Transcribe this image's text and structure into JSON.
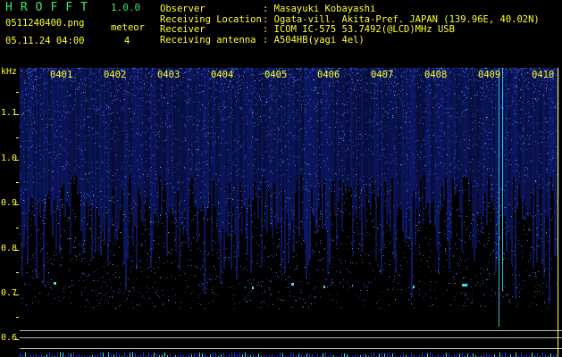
{
  "header": {
    "app_title": "HROFFT",
    "app_version": "1.0.0",
    "filename": "0511240400.png",
    "datetime": "05.11.24 04:00",
    "meteor_label": "meteor",
    "meteor_count": "4"
  },
  "info": {
    "labels": [
      "Observer",
      "Receiving Location",
      "Receiver",
      "Receiving antenna"
    ],
    "values": [
      ": Masayuki Kobayashi",
      ": Ogata-vill. Akita-Pref. JAPAN (139.96E, 40.02N)",
      ": ICOM IC-575 53.7492(@LCD)MHz USB",
      ": A504HB(yagi 4el)"
    ]
  },
  "axis": {
    "unit": "kHz",
    "tick_labels": [
      "1.1",
      "1.0",
      "0.9",
      "0.8",
      "0.7",
      "0.6"
    ],
    "minute_labels": [
      "0401",
      "0402",
      "0403",
      "0404",
      "0405",
      "0406",
      "0407",
      "0408",
      "0409",
      "0410"
    ]
  },
  "colors": {
    "background": "#000000",
    "text_yellow": "#ffff30",
    "title_green": "#3ee86a",
    "signal_blue": "#1e3cff",
    "signal_cyan": "#40e0ff",
    "guide_line": "#b9b9b9"
  }
}
